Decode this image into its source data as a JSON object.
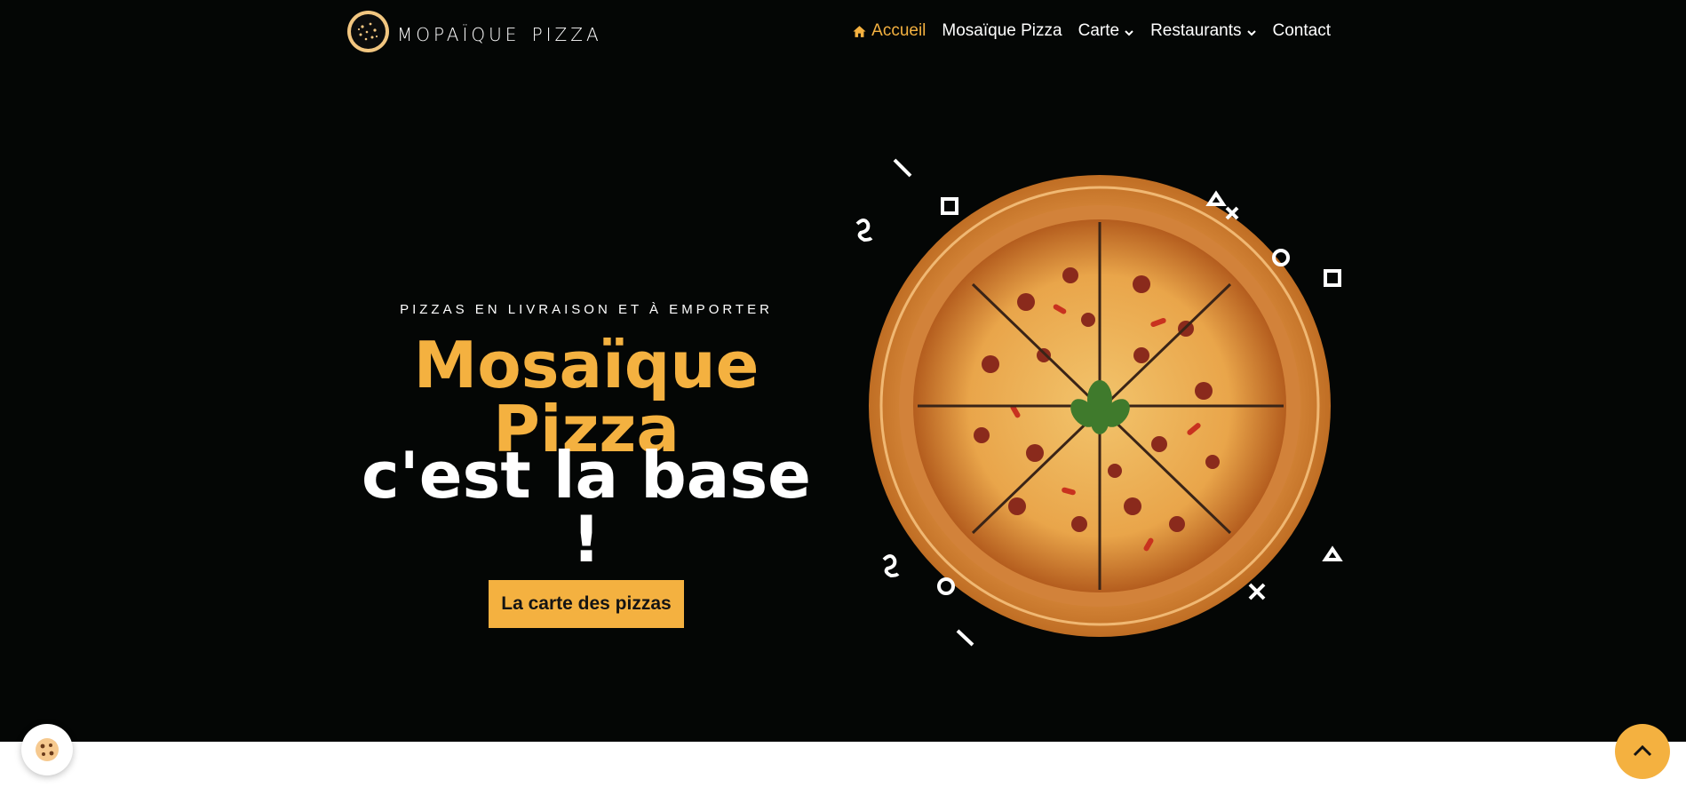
{
  "brand": {
    "name": "mopaïque pizza"
  },
  "nav": {
    "items": [
      {
        "label": "Accueil",
        "icon": "home-icon",
        "active": true
      },
      {
        "label": "Mosaïque Pizza"
      },
      {
        "label": "Carte",
        "dropdown": true
      },
      {
        "label": "Restaurants",
        "dropdown": true
      },
      {
        "label": "Contact"
      }
    ]
  },
  "hero": {
    "eyebrow": "PIZZAS EN LIVRAISON ET À EMPORTER",
    "title_line1": "Mosaïque Pizza",
    "title_line2": "c'est la base !",
    "cta_label": "La carte des pizzas"
  },
  "icons": {
    "cookie": "cookie-icon",
    "scroll_top": "chevron-up-icon"
  },
  "colors": {
    "accent": "#f4b140",
    "hero_bg": "#040605",
    "text": "#ffffff"
  }
}
